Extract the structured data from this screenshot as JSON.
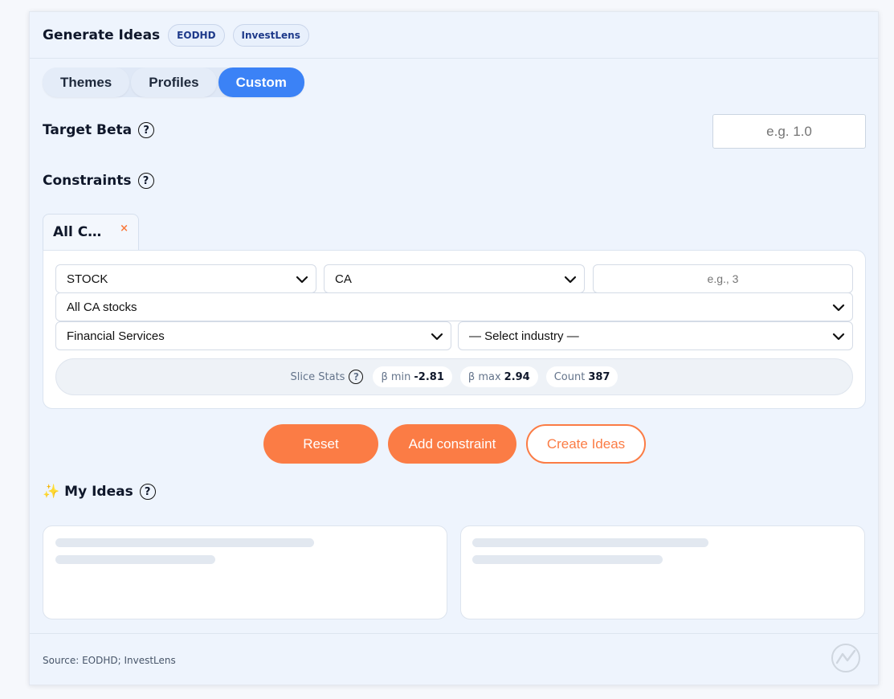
{
  "header": {
    "title": "Generate Ideas",
    "badges": [
      "EODHD",
      "InvestLens"
    ]
  },
  "tabs": [
    {
      "label": "Themes",
      "active": false
    },
    {
      "label": "Profiles",
      "active": false
    },
    {
      "label": "Custom",
      "active": true
    }
  ],
  "target_beta": {
    "label": "Target Beta",
    "placeholder": "e.g. 1.0",
    "value": ""
  },
  "constraints": {
    "label": "Constraints",
    "tab_label": "All C…",
    "tab_close": "×",
    "asset_type": "STOCK",
    "country": "CA",
    "count_placeholder": "e.g., 3",
    "universe": "All CA stocks",
    "sector": "Financial Services",
    "industry": "— Select industry —",
    "slice_stats": {
      "label": "Slice Stats",
      "beta_min_label": "β min",
      "beta_min": "-2.81",
      "beta_max_label": "β max",
      "beta_max": "2.94",
      "count_label": "Count",
      "count": "387"
    }
  },
  "actions": {
    "reset": "Reset",
    "add_constraint": "Add constraint",
    "create_ideas": "Create Ideas"
  },
  "my_ideas": {
    "icon": "sparkles-icon",
    "emoji": "✨",
    "label": "My Ideas"
  },
  "footer": {
    "source": "Source: EODHD; InvestLens"
  },
  "colors": {
    "accent_blue": "#3b82f6",
    "accent_orange": "#fb7c45",
    "badge_text": "#1e3a8a"
  }
}
